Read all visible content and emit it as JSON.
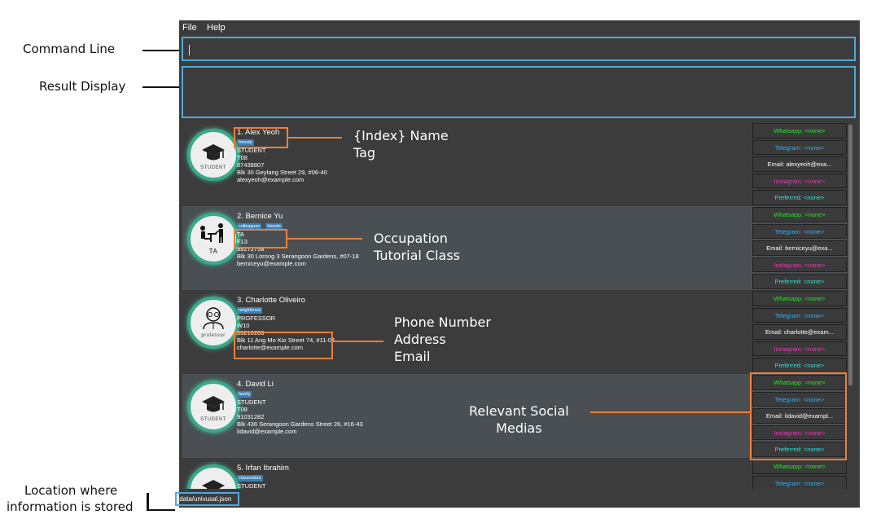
{
  "annotations": {
    "command_line": "Command Line",
    "result_display": "Result Display",
    "location_line1": "Location where",
    "location_line2": "information is stored",
    "index_name_tag": [
      "{Index} Name",
      "Tag"
    ],
    "occupation": [
      "Occupation",
      "Tutorial Class"
    ],
    "contact": [
      "Phone Number",
      "Address",
      "Email"
    ],
    "social": [
      "Relevant Social",
      "Medias"
    ]
  },
  "menu": {
    "file": "File",
    "help": "Help"
  },
  "command_input": {
    "value": ""
  },
  "result_display": {
    "text": ""
  },
  "persons": [
    {
      "index_name": "1.  Alex Yeoh",
      "tags": [
        "friends"
      ],
      "occupation": "STUDENT",
      "tutorial": "T08",
      "phone": "87438807",
      "address": "Blk 30 Geylang Street 29, #06-40",
      "email": "alexyeoh@example.com",
      "avatar_label": "STUDENT",
      "avatar_icon": "graduation-cap-icon",
      "social": {
        "whatsapp": "Whatsapp: <none>",
        "telegram": "Telegram: <none>",
        "email": "Email: alexyeoh@exa...",
        "instagram": "Instagram: <none>",
        "preferred": "Preferred: <none>"
      }
    },
    {
      "index_name": "2.  Bernice Yu",
      "tags": [
        "colleagues",
        "friends"
      ],
      "occupation": "TA",
      "tutorial": "F13",
      "phone": "99272758",
      "address": "Blk 30 Lorong 3 Serangoon Gardens, #07-18",
      "email": "berniceyu@example.com",
      "avatar_label": "TA",
      "avatar_icon": "teaching-assistant-icon",
      "social": {
        "whatsapp": "Whatsapp: <none>",
        "telegram": "Telegram: <none>",
        "email": "Email: berniceyu@exa...",
        "instagram": "Instagram: <none>",
        "preferred": "Preferred: <none>"
      }
    },
    {
      "index_name": "3.  Charlotte Oliveiro",
      "tags": [
        "neighbours"
      ],
      "occupation": "PROFESSOR",
      "tutorial": "W10",
      "phone": "93210283",
      "address": "Blk 11 Ang Mo Kio Street 74, #11-04",
      "email": "charlotte@example.com",
      "avatar_label": "professor",
      "avatar_icon": "professor-icon",
      "social": {
        "whatsapp": "Whatsapp: <none>",
        "telegram": "Telegram: <none>",
        "email": "Email: charlotte@exam...",
        "instagram": "Instagram: <none>",
        "preferred": "Preferred: <none>"
      }
    },
    {
      "index_name": "4.  David Li",
      "tags": [
        "family"
      ],
      "occupation": "STUDENT",
      "tutorial": "T08",
      "phone": "91031282",
      "address": "Blk 436 Serangoon Gardens Street 26, #16-43",
      "email": "lidavid@example.com",
      "avatar_label": "STUDENT",
      "avatar_icon": "graduation-cap-icon",
      "social": {
        "whatsapp": "Whatsapp: <none>",
        "telegram": "Telegram: <none>",
        "email": "Email: lidavid@exampl...",
        "instagram": "Instagram: <none>",
        "preferred": "Preferred: <none>"
      }
    },
    {
      "index_name": "5.  Irfan Ibrahim",
      "tags": [
        "classmates"
      ],
      "occupation": "STUDENT",
      "tutorial": "",
      "phone": "",
      "address": "",
      "email": "",
      "avatar_label": "",
      "avatar_icon": "graduation-cap-icon",
      "social": {
        "whatsapp": "Whatsapp: <none>",
        "telegram": "Telegram: <none>",
        "email": "",
        "instagram": "",
        "preferred": ""
      }
    }
  ],
  "status_bar": {
    "path": "/data/univusal.json"
  },
  "colors": {
    "accent_blue": "#52a8d9",
    "annotation_orange": "#ee7f3a",
    "whatsapp": "#2fe02f",
    "telegram": "#2ab0ff",
    "instagram": "#e040b0",
    "preferred": "#2ee0d8"
  }
}
